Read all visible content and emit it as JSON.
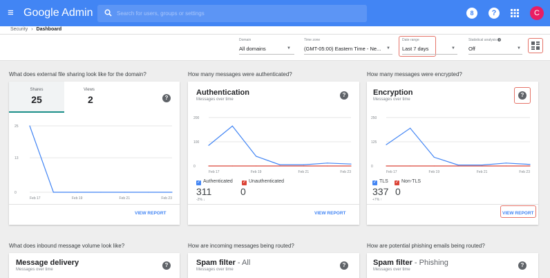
{
  "header": {
    "app_title": "Google Admin",
    "search_placeholder": "Search for users, groups or settings",
    "avatar_letter": "C",
    "icons": [
      "menu-icon",
      "search-icon",
      "support-icon",
      "help-icon",
      "apps-grid-icon"
    ],
    "brand_color": "#4285f4"
  },
  "breadcrumb": {
    "parent": "Security",
    "separator": "›",
    "current": "Dashboard"
  },
  "filters": {
    "domain": {
      "label": "Domain",
      "value": "All domains"
    },
    "timezone": {
      "label": "Time zone",
      "value": "(GMT-05:00) Eastern Time - Ne..."
    },
    "date_range": {
      "label": "Date range",
      "value": "Last 7 days"
    },
    "stat_analysis": {
      "label": "Statistical analysis",
      "value": "Off"
    }
  },
  "questions": {
    "q1": "What does external file sharing look like for the domain?",
    "q2": "How many messages were authenticated?",
    "q3": "How many messages were encrypted?",
    "q4": "What does inbound message volume look like?",
    "q5": "How are incoming messages being routed?",
    "q6": "How are potential phishing emails being routed?"
  },
  "sharing": {
    "tab1_label": "Shares",
    "tab1_value": "25",
    "tab2_label": "Views",
    "tab2_value": "2",
    "view_report": "VIEW REPORT"
  },
  "authentication": {
    "title": "Authentication",
    "subtitle": "Messages over time",
    "legend_a": "Authenticated",
    "legend_b": "Unauthenticated",
    "value_a": "311",
    "value_b": "0",
    "delta": "-2% ↓",
    "view_report": "VIEW REPORT"
  },
  "encryption": {
    "title": "Encryption",
    "subtitle": "Messages over time",
    "legend_a": "TLS",
    "legend_b": "Non-TLS",
    "value_a": "337",
    "value_b": "0",
    "delta": "+7% ↑",
    "view_report": "VIEW REPORT"
  },
  "bottom_cards": {
    "delivery_title": "Message delivery",
    "delivery_sub": "Messages over time",
    "spam_title": "Spam filter",
    "spam_suffix": "- All",
    "spam_sub": "Messages over time",
    "phish_title": "Spam filter",
    "phish_suffix": "- Phishing",
    "phish_sub": "Messages over time"
  },
  "chart_data": [
    {
      "type": "line",
      "x": [
        "Feb 17",
        "Feb 18",
        "Feb 19",
        "Feb 20",
        "Feb 21",
        "Feb 22",
        "Feb 23"
      ],
      "xticks": [
        "Feb 17",
        "Feb 19",
        "Feb 21",
        "Feb 23"
      ],
      "yticks": [
        "0",
        "13",
        "25"
      ],
      "ylim": [
        0,
        25
      ],
      "series": [
        {
          "color": "#4285f4",
          "values": [
            25,
            0,
            0,
            0,
            0,
            0,
            0
          ]
        }
      ]
    },
    {
      "type": "line",
      "x": [
        "Feb 17",
        "Feb 18",
        "Feb 19",
        "Feb 20",
        "Feb 21",
        "Feb 22",
        "Feb 23"
      ],
      "xticks": [
        "Feb 17",
        "Feb 19",
        "Feb 21",
        "Feb 23"
      ],
      "yticks": [
        "0",
        "100",
        "200"
      ],
      "ylim": [
        0,
        200
      ],
      "series": [
        {
          "name": "Authenticated",
          "color": "#4285f4",
          "values": [
            85,
            165,
            40,
            5,
            5,
            12,
            8
          ]
        },
        {
          "name": "Unauthenticated",
          "color": "#db4437",
          "values": [
            0,
            0,
            0,
            0,
            0,
            0,
            0
          ]
        }
      ]
    },
    {
      "type": "line",
      "x": [
        "Feb 17",
        "Feb 18",
        "Feb 19",
        "Feb 20",
        "Feb 21",
        "Feb 22",
        "Feb 23"
      ],
      "xticks": [
        "Feb 17",
        "Feb 19",
        "Feb 21",
        "Feb 23"
      ],
      "yticks": [
        "0",
        "125",
        "250"
      ],
      "ylim": [
        0,
        250
      ],
      "series": [
        {
          "name": "TLS",
          "color": "#4285f4",
          "values": [
            110,
            195,
            45,
            5,
            5,
            15,
            8
          ]
        },
        {
          "name": "Non-TLS",
          "color": "#db4437",
          "values": [
            0,
            0,
            0,
            0,
            0,
            0,
            0
          ]
        }
      ]
    }
  ]
}
